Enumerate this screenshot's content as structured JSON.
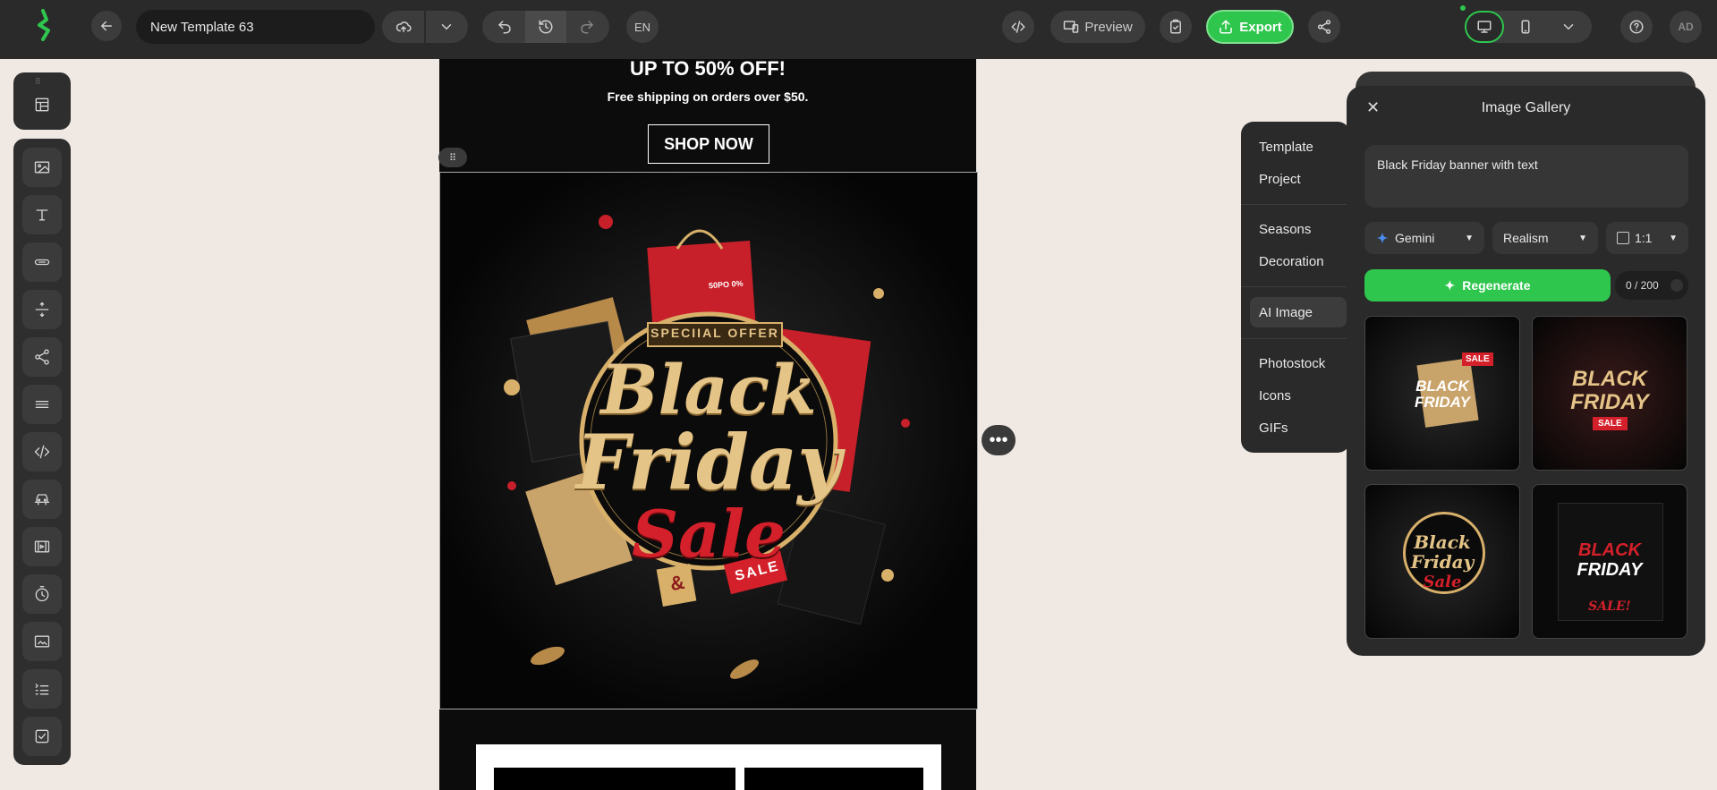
{
  "topbar": {
    "template_name": "New Template 63",
    "language": "EN",
    "preview_label": "Preview",
    "export_label": "Export",
    "avatar_initials": "AD"
  },
  "email": {
    "headline": "UP TO 50% OFF!",
    "subline": "Free shipping on orders over $50.",
    "cta": "SHOP NOW",
    "banner": {
      "tag": "SPECIIAL OFFER",
      "line1": "Black",
      "line2": "Friday",
      "line3": "Sale",
      "bag_text": "50PO 0%",
      "sale_tag": "SALE",
      "amp": "&"
    }
  },
  "content_menu": {
    "items": [
      "Template",
      "Project",
      "Seasons",
      "Decoration",
      "AI Image",
      "Photostock",
      "Icons",
      "GIFs"
    ],
    "active": "AI Image"
  },
  "gallery": {
    "title": "Image Gallery",
    "prompt": "Black Friday banner with text",
    "model": "Gemini",
    "style": "Realism",
    "ratio": "1:1",
    "regenerate_label": "Regenerate",
    "counter": "0 / 200",
    "thumbs": [
      {
        "l1": "BLACK",
        "l2": "FRIDAY",
        "tag": "SALE"
      },
      {
        "l1": "BLACK",
        "l2": "FRIDAY",
        "tag": "SALE"
      },
      {
        "l1": "Black",
        "l2": "Friday",
        "tag": "Sale"
      },
      {
        "l1": "BLACK",
        "l2": "FRIDAY",
        "tag": "SALE!"
      }
    ]
  },
  "colors": {
    "accent_green": "#2fc64d",
    "topbar_bg": "#2a2a2a",
    "workspace_bg": "#efe8e3",
    "gold": "#d8b06a",
    "red": "#d4202a"
  }
}
